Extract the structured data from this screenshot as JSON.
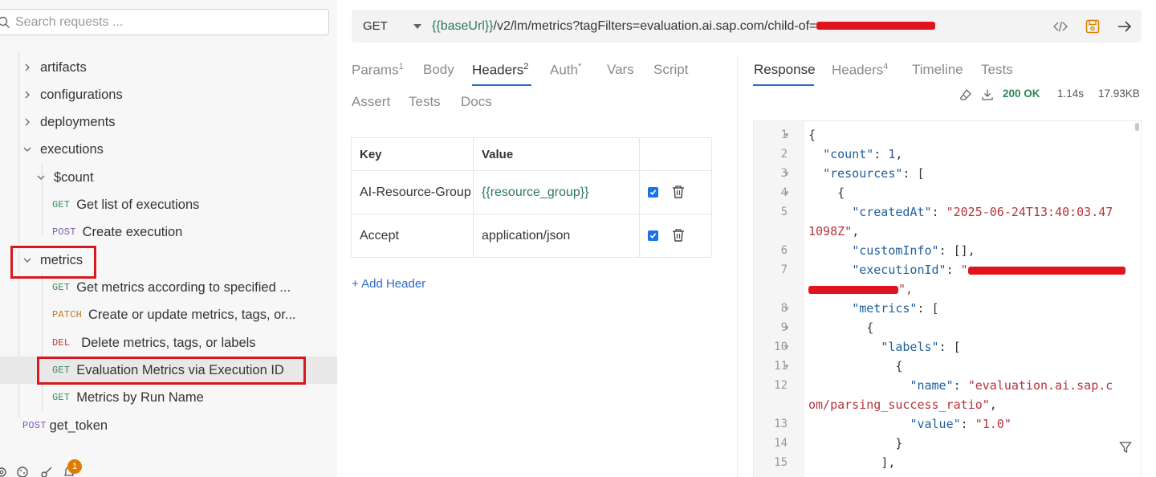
{
  "sidebar": {
    "search_placeholder": "Search requests ...",
    "items": [
      {
        "label": "artifacts"
      },
      {
        "label": "configurations"
      },
      {
        "label": "deployments"
      },
      {
        "label": "executions"
      },
      {
        "label": "$count"
      },
      {
        "method": "GET",
        "label": "Get list of executions"
      },
      {
        "method": "POST",
        "label": "Create execution"
      },
      {
        "label": "metrics"
      },
      {
        "method": "GET",
        "label": "Get metrics according to specified ..."
      },
      {
        "method": "PATCH",
        "label": "Create or update metrics, tags, or..."
      },
      {
        "method": "DEL",
        "label": "Delete metrics, tags, or labels"
      },
      {
        "method": "GET",
        "label": "Evaluation Metrics via Execution ID"
      },
      {
        "method": "GET",
        "label": "Metrics by Run Name"
      },
      {
        "method": "POST",
        "label": "get_token"
      }
    ],
    "notification_count": "1"
  },
  "url_bar": {
    "method": "GET",
    "url_var": "{{baseUrl}}",
    "url_path": "/v2/lm/metrics?tagFilters=evaluation.ai.sap.com/child-of="
  },
  "request_tabs": [
    {
      "label": "Params",
      "sup": "1"
    },
    {
      "label": "Body",
      "sup": ""
    },
    {
      "label": "Headers",
      "sup": "2"
    },
    {
      "label": "Auth",
      "sup": "*"
    },
    {
      "label": "Vars",
      "sup": ""
    },
    {
      "label": "Script",
      "sup": ""
    },
    {
      "label": "Assert",
      "sup": ""
    },
    {
      "label": "Tests",
      "sup": ""
    },
    {
      "label": "Docs",
      "sup": ""
    }
  ],
  "headers_table": {
    "columns": [
      "Key",
      "Value"
    ],
    "rows": [
      {
        "key": "AI-Resource-Group",
        "value": "{{resource_group}}",
        "enabled": true
      },
      {
        "key": "Accept",
        "value": "application/json",
        "enabled": true
      }
    ],
    "add_label": "+ Add Header"
  },
  "response_tabs": [
    {
      "label": "Response",
      "sup": ""
    },
    {
      "label": "Headers",
      "sup": "4"
    },
    {
      "label": "Timeline",
      "sup": ""
    },
    {
      "label": "Tests",
      "sup": ""
    }
  ],
  "response_status": {
    "status": "200 OK",
    "time": "1.14s",
    "size": "17.93KB"
  },
  "response_body": {
    "line_numbers": [
      "1",
      "2",
      "3",
      "4",
      "5",
      "",
      "6",
      "7",
      "",
      "8",
      "9",
      "10",
      "11",
      "12",
      "",
      "13",
      "14",
      "15"
    ],
    "line_1": "{",
    "line_2_key": "\"count\"",
    "line_2_val": "1",
    "line_3_key": "\"resources\"",
    "line_3_rest": ": [",
    "line_4": "{",
    "line_5_key": "\"createdAt\"",
    "line_5_val_a": "\"2025-06-24T13:40:03.47",
    "line_5_val_b": "1098Z\"",
    "line_6_key": "\"customInfo\"",
    "line_6_rest": ": [],",
    "line_7_key": "\"executionId\"",
    "line_7_val_a": "\"",
    "line_7_val_b": "\",",
    "line_8_key": "\"metrics\"",
    "line_8_rest": ": [",
    "line_9": "{",
    "line_10_key": "\"labels\"",
    "line_10_rest": ": [",
    "line_11": "{",
    "line_12_key": "\"name\"",
    "line_12_val_a": "\"evaluation.ai.sap.c",
    "line_12_val_b": "om/parsing_success_ratio\"",
    "line_13_key": "\"value\"",
    "line_13_val": "\"1.0\"",
    "line_14": "}",
    "line_15": "],"
  },
  "colors": {
    "accent": "#2c69c7",
    "highlight_box": "#d7191c",
    "status_ok": "#2e8a55",
    "redaction": "#e0141e"
  }
}
